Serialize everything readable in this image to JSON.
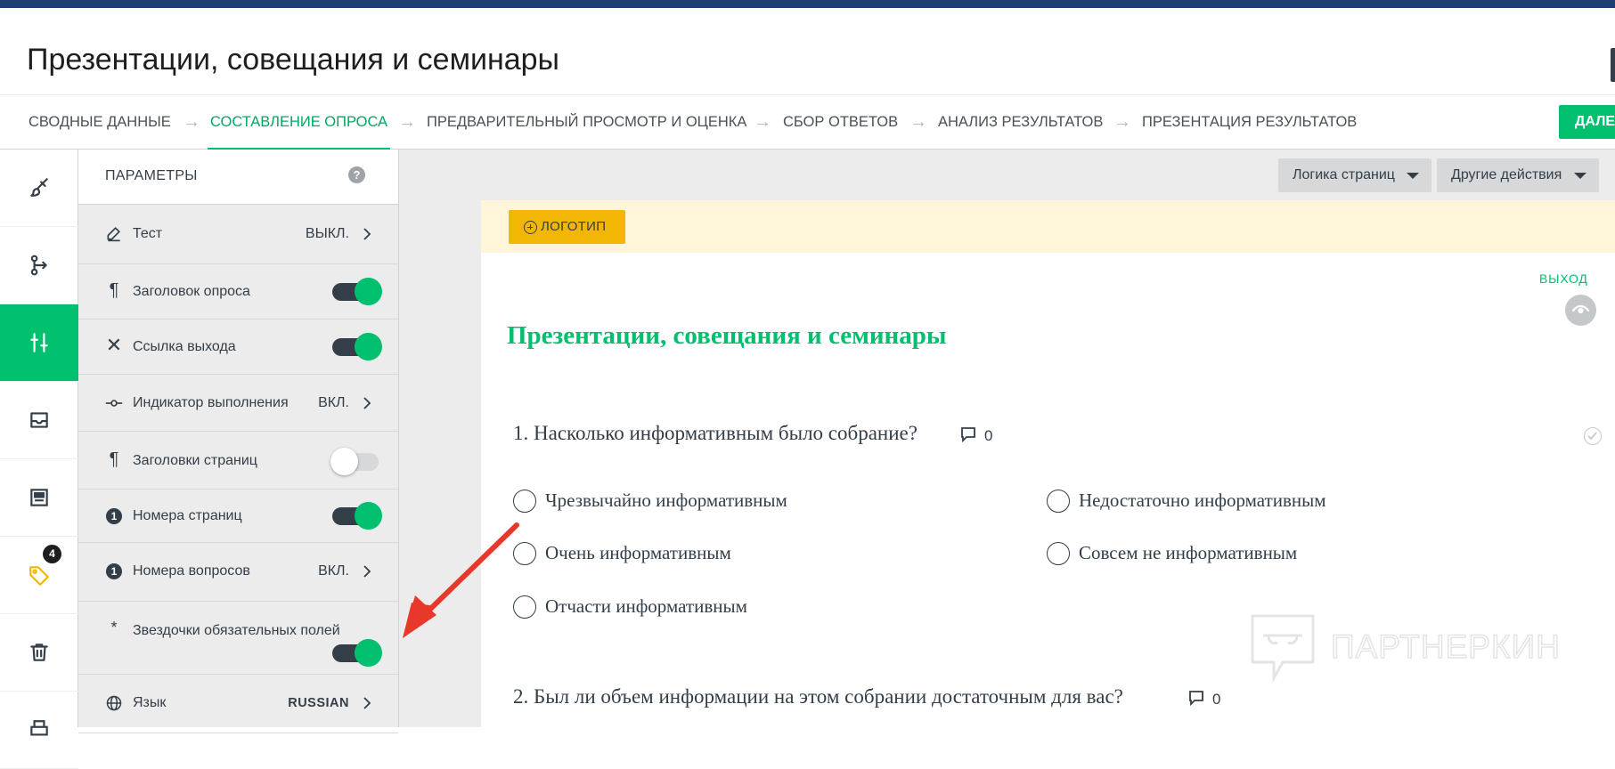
{
  "window": {
    "title": "Презентации, совещания и семинары"
  },
  "steps": {
    "items": [
      {
        "label": "СВОДНЫЕ ДАННЫЕ"
      },
      {
        "label": "СОСТАВЛЕНИЕ ОПРОСА"
      },
      {
        "label": "ПРЕДВАРИТЕЛЬНЫЙ ПРОСМОТР И ОЦЕНКА"
      },
      {
        "label": "СБОР ОТВЕТОВ"
      },
      {
        "label": "АНАЛИЗ РЕЗУЛЬТАТОВ"
      },
      {
        "label": "ПРЕЗЕНТАЦИЯ РЕЗУЛЬТАТОВ"
      }
    ],
    "active": "СОСТАВЛЕНИЕ ОПРОСА",
    "next_label": "ДАЛЕ"
  },
  "rail": {
    "items": [
      {
        "icon": "paintbrush-icon"
      },
      {
        "icon": "logic-branch-icon"
      },
      {
        "icon": "sliders-icon",
        "active": true
      },
      {
        "icon": "inbox-icon"
      },
      {
        "icon": "layout-icon"
      },
      {
        "icon": "tag-icon",
        "badge": "4"
      },
      {
        "icon": "trash-icon"
      }
    ]
  },
  "params": {
    "header": "ПАРАМЕТРЫ",
    "help": "?",
    "rows": [
      {
        "label": "Тест",
        "value": "ВЫКЛ.",
        "icon": "pencil-icon"
      },
      {
        "label": "Заголовок опроса",
        "toggle": "on",
        "icon": "pilcrow-icon"
      },
      {
        "label": "Ссылка выхода",
        "toggle": "on",
        "icon": "close-icon"
      },
      {
        "label": "Индикатор выполнения",
        "value": "ВКЛ.",
        "icon": "progress-icon"
      },
      {
        "label": "Заголовки страниц",
        "toggle": "off",
        "icon": "pilcrow-icon"
      },
      {
        "label": "Номера страниц",
        "toggle": "on",
        "icon": "number-one-icon",
        "icon_text": "1"
      },
      {
        "label": "Номера вопросов",
        "value": "ВКЛ.",
        "icon": "number-one-icon",
        "icon_text": "1"
      },
      {
        "label": "Звездочки обязательных полей",
        "toggle": "on",
        "icon": "asterisk-icon",
        "icon_text": "*"
      },
      {
        "label": "Язык",
        "value": "RUSSIAN",
        "icon": "globe-icon"
      }
    ]
  },
  "canvas": {
    "page_logic_label": "Логика страниц",
    "other_actions_label": "Другие действия",
    "logo_label": "ЛОГОТИП",
    "exit_label": "ВЫХОД",
    "survey_title": "Презентации, совещания и семинары",
    "questions": [
      {
        "title": "1. Насколько информативным было собрание?",
        "comments": "0",
        "options": [
          "Чрезвычайно информативным",
          "Недостаточно информативным",
          "Очень информативным",
          "Совсем не информативным",
          "Отчасти информативным"
        ]
      },
      {
        "title": "2. Был ли объем информации на этом собрании достаточным для вас?",
        "comments": "0"
      }
    ]
  },
  "watermark": {
    "text": "ПАРТНЕРКИН"
  },
  "colors": {
    "accent": "#00bf6f",
    "top_stripe": "#1f3f73",
    "logo_button": "#f2b705",
    "annotation_arrow": "#e8382b"
  }
}
